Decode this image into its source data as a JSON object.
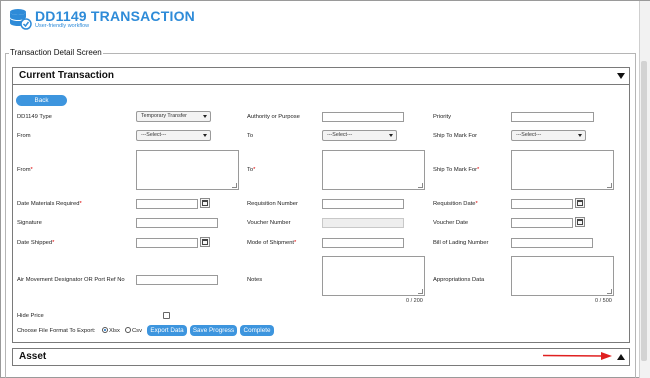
{
  "app": {
    "title": "DD1149 TRANSACTION",
    "subtitle": "User-friendly workflow",
    "logo": "database-icon",
    "accent": "#2e8bd8"
  },
  "fieldset": {
    "legend": "Transaction Detail Screen"
  },
  "current_panel": {
    "title": "Current Transaction",
    "toggle_icon": "triangle-down-icon"
  },
  "asset_panel": {
    "title": "Asset",
    "toggle_icon": "triangle-up-icon"
  },
  "buttons": {
    "back": "Back",
    "export": "Export Data",
    "save": "Save Progress",
    "complete": "Complete",
    "color": "#3d95de"
  },
  "fields": {
    "dd1149_type": {
      "label": "DD1149 Type",
      "value": "Temporary Transfer"
    },
    "authority": {
      "label": "Authority or Purpose",
      "value": ""
    },
    "priority": {
      "label": "Priority",
      "value": ""
    },
    "from_select": {
      "label": "From",
      "value": "---Select---"
    },
    "to_select": {
      "label": "To",
      "value": "---Select---"
    },
    "ship_to_select": {
      "label": "Ship To Mark For",
      "value": "---Select---"
    },
    "from_text": {
      "label": "From",
      "required": "*"
    },
    "to_text": {
      "label": "To",
      "required": "*"
    },
    "ship_to_text": {
      "label": "Ship To Mark For",
      "required": "*"
    },
    "date_materials": {
      "label": "Date Materials Required",
      "required": "*"
    },
    "requisition_number": {
      "label": "Requisition Number"
    },
    "requisition_date": {
      "label": "Requisition Date",
      "required": "*"
    },
    "signature": {
      "label": "Signature"
    },
    "voucher_number": {
      "label": "Voucher Number"
    },
    "voucher_date": {
      "label": "Voucher Date"
    },
    "date_shipped": {
      "label": "Date Shipped",
      "required": "*"
    },
    "mode_of_shipment": {
      "label": "Mode of Shipment",
      "required": "*"
    },
    "bill_of_lading": {
      "label": "Bill of Lading Number"
    },
    "air_movement": {
      "label": "Air Movement Designator OR Port Ref No"
    },
    "notes": {
      "label": "Notes",
      "counter": "0 / 200"
    },
    "appropriations": {
      "label": "Appropriations Data",
      "counter": "0 / 500"
    }
  },
  "hide_price": {
    "label": "Hide Price",
    "checked": false
  },
  "export_format": {
    "label": "Choose File Format To Export:",
    "options": [
      "Xlsx",
      "Csv"
    ],
    "selected": "Xlsx"
  },
  "annotation": {
    "icon": "red-arrow-icon",
    "color": "#e02020"
  }
}
